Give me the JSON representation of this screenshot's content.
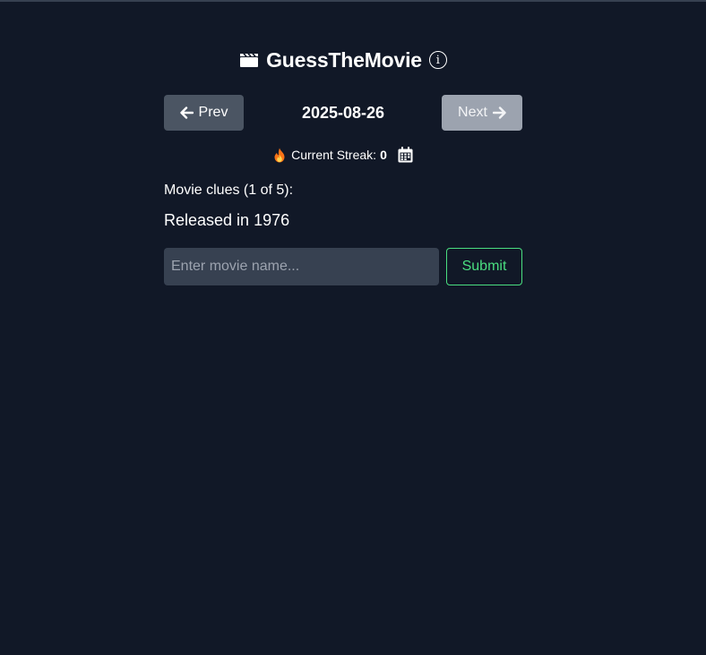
{
  "app": {
    "title": "GuessTheMovie",
    "logo_icon": "clapperboard-icon",
    "info_icon": "info-circle-icon"
  },
  "navigation": {
    "prev_label": "Prev",
    "next_label": "Next",
    "date": "2025-08-26",
    "prev_icon": "arrow-left-icon",
    "next_icon": "arrow-right-icon",
    "next_disabled": true
  },
  "streak": {
    "icon": "fire-icon",
    "label": "Current Streak:",
    "value": "0",
    "calendar_icon": "calendar-icon"
  },
  "clues": {
    "heading": "Movie clues (1 of 5):",
    "current_clue": "Released in 1976"
  },
  "guess": {
    "placeholder": "Enter movie name...",
    "value": "",
    "submit_label": "Submit"
  },
  "colors": {
    "background": "#111827",
    "prev_button": "#4b5563",
    "next_button": "#9ca3af",
    "input_bg": "#374151",
    "submit_accent": "#4ade80"
  }
}
